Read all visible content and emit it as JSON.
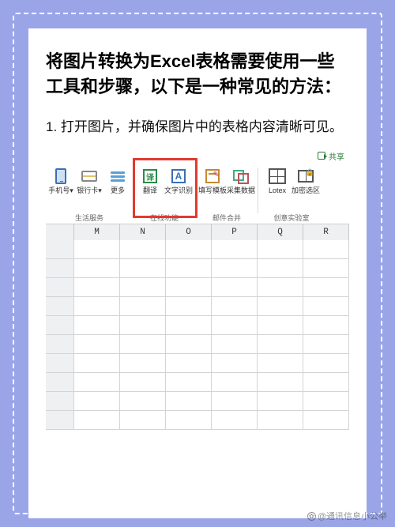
{
  "title": "将图片转换为Excel表格需要使用一些工具和步骤，以下是一种常见的方法：",
  "step1": "1. 打开图片，并确保图片中的表格内容清晰可见。",
  "excel": {
    "share": "共享",
    "groups": {
      "life": {
        "label": "生活服务",
        "phone": "手机号▾",
        "card": "银行卡▾",
        "more": "更多"
      },
      "online": {
        "label": "在线功能",
        "translate": "翻译",
        "ocr": "文字识别"
      },
      "mail": {
        "label": "邮件合并",
        "form": "填写模板",
        "collect": "采集数据"
      },
      "lab": {
        "label": "创意实验室",
        "lotex": "Lotex",
        "lock": "加密选区"
      }
    },
    "ocr_glyph": "A",
    "trans_glyph": "译",
    "columns": [
      "",
      "M",
      "N",
      "O",
      "P",
      "Q",
      "R"
    ]
  },
  "watermark": "@通讯信息小公举"
}
